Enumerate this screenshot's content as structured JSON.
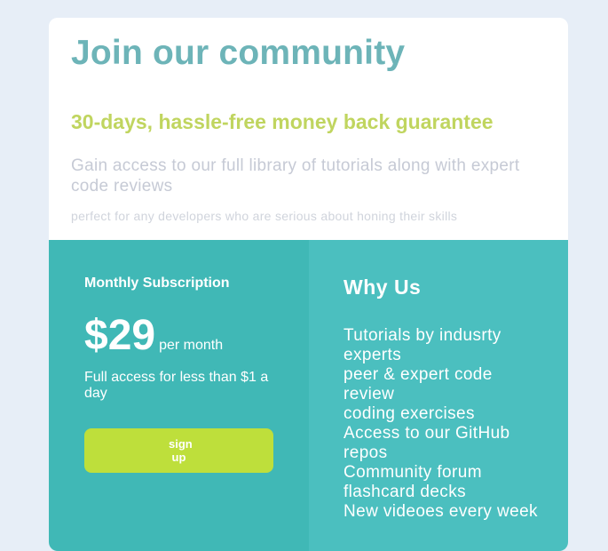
{
  "header": {
    "title": "Join our community",
    "guarantee": "30-days, hassle-free money back guarantee",
    "lead": "Gain access to our full library of tutorials along with expert code reviews",
    "sub": "perfect for any developers who are serious about honing their skills"
  },
  "subscription": {
    "label": "Monthly Subscription",
    "price": "$29",
    "period": "per month",
    "description": "Full access for less than $1 a day",
    "button_label": "sign up"
  },
  "why": {
    "title": "Why Us",
    "items": [
      "Tutorials by indusrty experts",
      "peer & expert code review",
      "coding exercises",
      "Access to our GitHub repos",
      "Community forum",
      "flashcard decks",
      "New videoes every week"
    ]
  },
  "colors": {
    "background": "#e7eef7",
    "title": "#6db4b8",
    "guarantee": "#c0d55f",
    "left_panel": "#40b8b6",
    "right_panel": "#4bbfbf",
    "button": "#bedf3b"
  }
}
